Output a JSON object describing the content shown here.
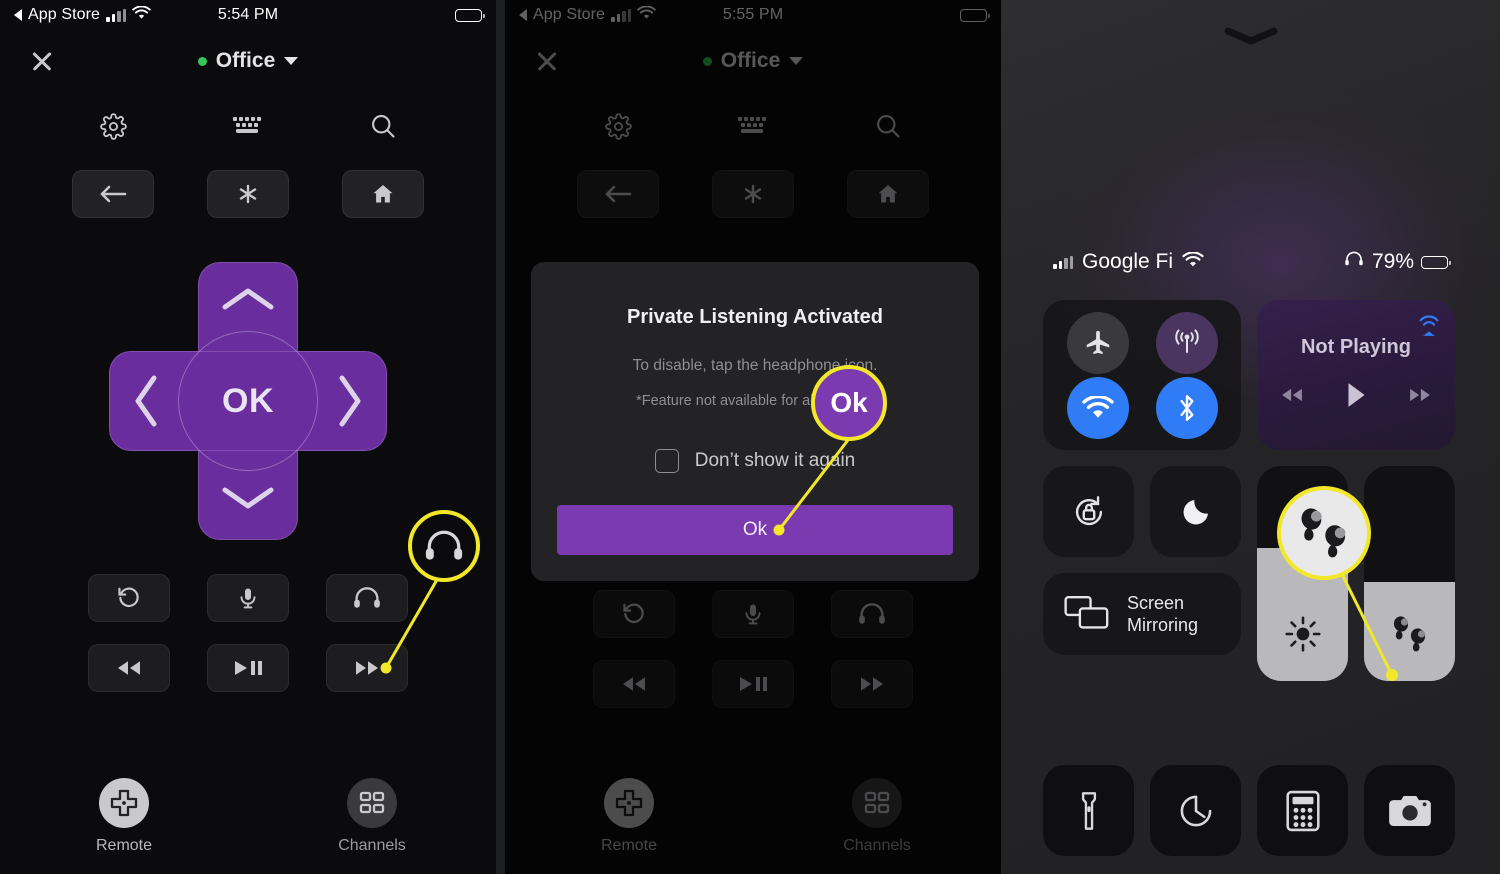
{
  "theme": {
    "purple": "#6a2d9e",
    "purple_light": "#7b3ab0",
    "callout_yellow": "#f2e829",
    "accent_blue": "#2f7cf6",
    "status_green": "#35c759"
  },
  "panels": {
    "left": {
      "status_bar": {
        "back_label": "App Store",
        "time": "5:54 PM",
        "signal_icon": "cellular-bars-icon",
        "wifi_icon": "wifi-icon",
        "battery_icon": "battery-icon"
      },
      "header": {
        "close_icon": "close-icon",
        "device_name": "Office",
        "status_dot": "online-dot-icon",
        "caret_icon": "chevron-down-icon"
      },
      "toolbar": [
        {
          "name": "settings-icon",
          "label": "Settings"
        },
        {
          "name": "keyboard-icon",
          "label": "Keyboard"
        },
        {
          "name": "search-icon",
          "label": "Search"
        }
      ],
      "top_keys": [
        {
          "name": "back-icon",
          "label": "Back"
        },
        {
          "name": "options-star-icon",
          "label": "Options"
        },
        {
          "name": "home-icon",
          "label": "Home"
        }
      ],
      "dpad": {
        "ok_label": "OK",
        "up_icon": "chevron-up-icon",
        "down_icon": "chevron-down-icon",
        "left_icon": "chevron-left-icon",
        "right_icon": "chevron-right-icon"
      },
      "controls": [
        {
          "name": "replay-icon",
          "label": "Instant Replay"
        },
        {
          "name": "microphone-icon",
          "label": "Voice"
        },
        {
          "name": "headphone-icon",
          "label": "Private Listening"
        },
        {
          "name": "rewind-icon",
          "label": "Rewind"
        },
        {
          "name": "play-pause-icon",
          "label": "Play / Pause"
        },
        {
          "name": "fast-forward-icon",
          "label": "Fast Forward"
        }
      ],
      "tabs": [
        {
          "name": "tab-remote",
          "label": "Remote",
          "icon": "dpad-icon",
          "active": true
        },
        {
          "name": "tab-channels",
          "label": "Channels",
          "icon": "grid-icon",
          "active": false
        }
      ],
      "callout": {
        "icon": "headphone-icon",
        "note": "highlights the private-listening headphone button"
      }
    },
    "middle": {
      "status_bar": {
        "back_label": "App Store",
        "time": "5:55 PM"
      },
      "header": {
        "device_name": "Office"
      },
      "dialog": {
        "title": "Private Listening Activated",
        "line1": "To disable, tap the headphone icon.",
        "line2": "*Feature not available for all devices.",
        "checkbox_label": "Don’t show it again",
        "checkbox_checked": false,
        "primary_button": "Ok"
      },
      "callout": {
        "label": "Ok",
        "note": "highlights the Ok confirmation button"
      },
      "tabs": [
        {
          "name": "tab-remote",
          "label": "Remote"
        },
        {
          "name": "tab-channels",
          "label": "Channels"
        }
      ]
    },
    "right": {
      "grabber_icon": "chevron-down-icon",
      "status_bar": {
        "carrier": "Google Fi",
        "signal_icon": "cellular-bars-icon",
        "wifi_icon": "wifi-icon",
        "headphone_icon": "headphone-icon",
        "battery_percent": "79%",
        "battery_icon": "battery-icon"
      },
      "connectivity": [
        {
          "name": "airplane-mode-button",
          "icon": "airplane-icon",
          "state": "off"
        },
        {
          "name": "cellular-data-button",
          "icon": "cellular-antenna-icon",
          "state": "off"
        },
        {
          "name": "wifi-button",
          "icon": "wifi-icon",
          "state": "on"
        },
        {
          "name": "bluetooth-button",
          "icon": "bluetooth-icon",
          "state": "on"
        }
      ],
      "now_playing": {
        "title": "Not Playing",
        "airplay_icon": "airplay-audio-icon",
        "previous_icon": "rewind-icon",
        "play_icon": "play-icon",
        "next_icon": "fast-forward-icon"
      },
      "toggles": [
        {
          "name": "rotation-lock-button",
          "icon": "rotation-lock-icon"
        },
        {
          "name": "do-not-disturb-button",
          "icon": "moon-icon"
        }
      ],
      "screen_mirroring": {
        "label_line1": "Screen",
        "label_line2": "Mirroring",
        "icon": "screen-mirroring-icon"
      },
      "sliders": [
        {
          "name": "brightness-slider",
          "icon": "brightness-icon",
          "level_percent": 62
        },
        {
          "name": "volume-slider",
          "icon": "earbuds-icon",
          "level_percent": 46
        }
      ],
      "apps": [
        {
          "name": "flashlight-button",
          "icon": "flashlight-icon"
        },
        {
          "name": "timer-button",
          "icon": "timer-icon"
        },
        {
          "name": "calculator-button",
          "icon": "calculator-icon"
        },
        {
          "name": "camera-button",
          "icon": "camera-icon"
        }
      ],
      "callout": {
        "icon": "earbuds-icon",
        "note": "highlights the earbuds volume slider"
      }
    }
  }
}
